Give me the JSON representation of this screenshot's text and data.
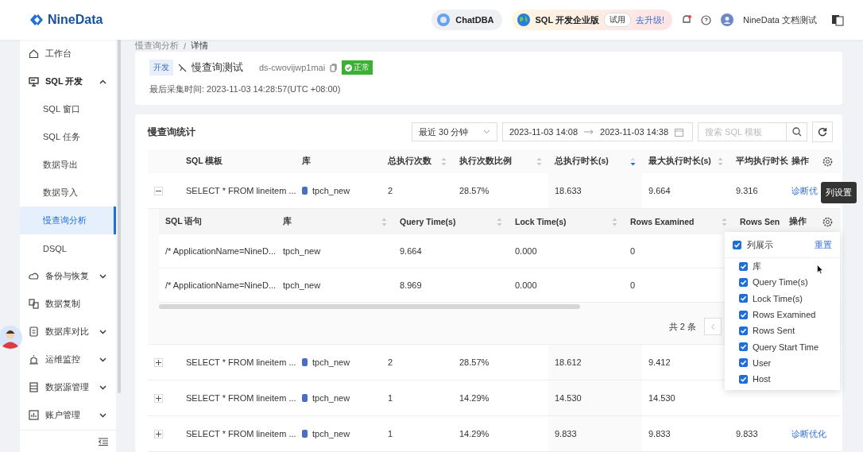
{
  "header": {
    "logo": "NineData",
    "chatdba": "ChatDBA",
    "edition": "SQL 开发企业版",
    "trial": "试用",
    "upgrade": "去升级!",
    "user": "NineData 文档测试"
  },
  "sidebar": {
    "items": [
      {
        "label": "工作台",
        "selected": false
      },
      {
        "label": "SQL 开发",
        "expanded": true,
        "selected": false,
        "children": [
          {
            "label": "SQL 窗口",
            "selected": false
          },
          {
            "label": "SQL 任务",
            "selected": false
          },
          {
            "label": "数据导出",
            "selected": false
          },
          {
            "label": "数据导入",
            "selected": false
          },
          {
            "label": "慢查询分析",
            "selected": true
          },
          {
            "label": "DSQL",
            "selected": false
          }
        ]
      },
      {
        "label": "备份与恢复",
        "expanded": false,
        "selected": false
      },
      {
        "label": "数据复制",
        "selected": false
      },
      {
        "label": "数据库对比",
        "expanded": false,
        "selected": false
      },
      {
        "label": "运维监控",
        "expanded": false,
        "selected": false
      },
      {
        "label": "数据源管理",
        "expanded": false,
        "selected": false
      },
      {
        "label": "账户管理",
        "expanded": false,
        "selected": false
      }
    ]
  },
  "breadcrumb": [
    "慢查询分析",
    "详情"
  ],
  "breadcrumb_separator": "/",
  "instance": {
    "env": "开发",
    "name": "慢查询测试",
    "id": "ds-cwovijwp1mai",
    "status": "正常",
    "collected": "最后采集时间: 2023-11-03 14:28:57(UTC +08:00)"
  },
  "stats": {
    "title": "慢查询统计",
    "range": "最近 30 分钟",
    "date_start": "2023-11-03 14:08",
    "date_end": "2023-11-03 14:38",
    "search": {
      "placeholder": "搜索 SQL 模板"
    },
    "columns": [
      {
        "label": "SQL 模板",
        "sortable": false
      },
      {
        "label": "库",
        "sortable": false
      },
      {
        "label": "总执行次数",
        "sortable": true,
        "sorted": false
      },
      {
        "label": "执行次数比例",
        "sortable": true,
        "sorted": false
      },
      {
        "label": "总执行时长(s)",
        "sortable": true,
        "sorted": true
      },
      {
        "label": "最大执行时长(s)",
        "sortable": true,
        "sorted": false
      },
      {
        "label": "平均执行时长",
        "sortable": false
      },
      {
        "label": "操作",
        "sortable": false
      }
    ],
    "rows": [
      {
        "expanded": true,
        "sql": "SELECT * FROM lineitem ...",
        "db": "tpch_new",
        "count": "2",
        "ratio": "28.57%",
        "total": "18.633",
        "max": "9.664",
        "avg": "9.316",
        "action": "诊断优"
      },
      {
        "expanded": false,
        "sql": "SELECT * FROM lineitem ...",
        "db": "tpch_new",
        "count": "2",
        "ratio": "28.57%",
        "total": "18.612",
        "max": "9.412"
      },
      {
        "expanded": false,
        "sql": "SELECT * FROM lineitem ...",
        "db": "tpch_new",
        "count": "1",
        "ratio": "14.29%",
        "total": "14.530",
        "max": "14.530"
      },
      {
        "expanded": false,
        "sql": "SELECT * FROM lineitem ...",
        "db": "tpch_new",
        "count": "1",
        "ratio": "14.29%",
        "total": "9.833",
        "max": "9.833",
        "avg": "9.833",
        "action": "诊断优化"
      }
    ],
    "detail": {
      "columns": [
        {
          "label": "SQL 语句",
          "sortable": false
        },
        {
          "label": "库",
          "sortable": true
        },
        {
          "label": "Query Time(s)",
          "sortable": true
        },
        {
          "label": "Lock Time(s)",
          "sortable": true
        },
        {
          "label": "Rows Examined",
          "sortable": true
        },
        {
          "label": "Rows Sen",
          "sortable": false
        },
        {
          "label": "操作",
          "sortable": false
        }
      ],
      "rows": [
        [
          "/* ApplicationName=NineD...",
          "tpch_new",
          "9.664",
          "0.000",
          "0"
        ],
        [
          "/* ApplicationName=NineD...",
          "tpch_new",
          "8.969",
          "0.000",
          "0"
        ]
      ],
      "total": "共 2 条"
    }
  },
  "column_settings": {
    "tooltip": "列设置",
    "title": "列展示",
    "all_checked": true,
    "reset": "重置",
    "items": [
      {
        "label": "库",
        "checked": true
      },
      {
        "label": "Query Time(s)",
        "checked": true
      },
      {
        "label": "Lock Time(s)",
        "checked": true
      },
      {
        "label": "Rows Examined",
        "checked": true
      },
      {
        "label": "Rows Sent",
        "checked": true
      },
      {
        "label": "Query Start Time",
        "checked": true
      },
      {
        "label": "User",
        "checked": true
      },
      {
        "label": "Host",
        "checked": true
      }
    ]
  }
}
